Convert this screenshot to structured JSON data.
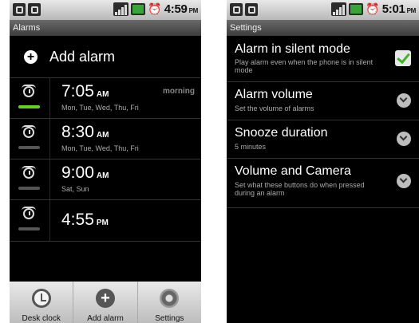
{
  "left_screen": {
    "status_time": "4:59",
    "status_ampm": "PM",
    "title": "Alarms",
    "add_alarm": "Add alarm",
    "alarms": [
      {
        "time": "7:05",
        "ampm": "AM",
        "days": "Mon, Tue, Wed, Thu, Fri",
        "label": "morning",
        "enabled": true
      },
      {
        "time": "8:30",
        "ampm": "AM",
        "days": "Mon, Tue, Wed, Thu, Fri",
        "label": "",
        "enabled": false
      },
      {
        "time": "9:00",
        "ampm": "AM",
        "days": "Sat, Sun",
        "label": "",
        "enabled": false
      },
      {
        "time": "4:55",
        "ampm": "PM",
        "days": "",
        "label": "",
        "enabled": false
      }
    ],
    "bottom_bar": [
      "Desk clock",
      "Add alarm",
      "Settings"
    ]
  },
  "right_screen": {
    "status_time": "5:01",
    "status_ampm": "PM",
    "title": "Settings",
    "items": [
      {
        "title": "Alarm in silent mode",
        "summary": "Play alarm even when the phone is in silent mode",
        "control": "checkbox",
        "checked": true
      },
      {
        "title": "Alarm volume",
        "summary": "Set the volume of alarms",
        "control": "chevron-icon"
      },
      {
        "title": "Snooze duration",
        "summary": "5 minutes",
        "control": "chevron-icon"
      },
      {
        "title": "Volume and Camera",
        "summary": "Set what these buttons do when pressed during an alarm",
        "control": "chevron-icon"
      }
    ]
  },
  "colors": {
    "enabled_bar": "#63d31e",
    "checkbox_check": "#3fb52a"
  }
}
